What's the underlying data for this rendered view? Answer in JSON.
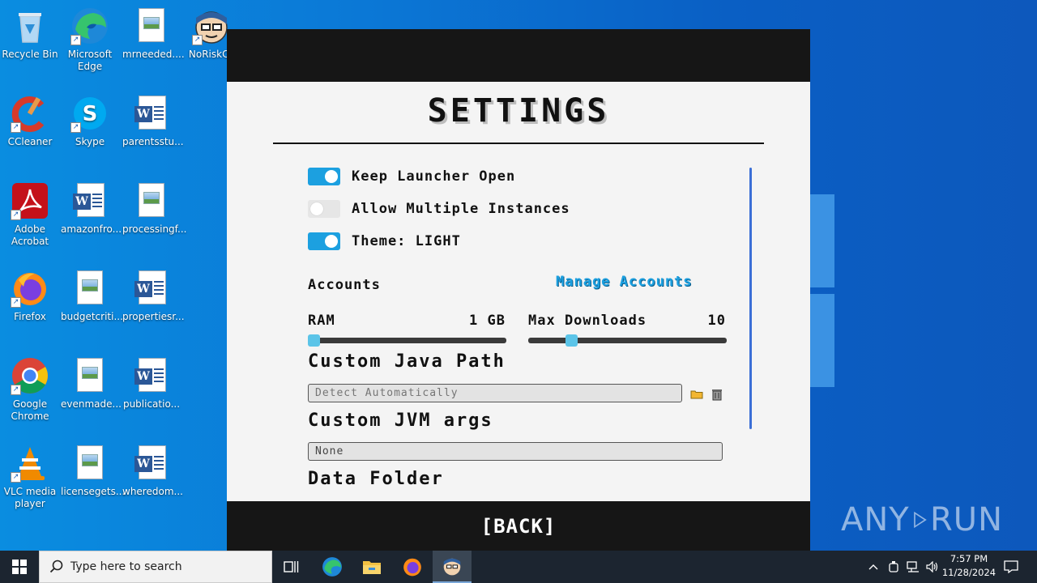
{
  "desktop": {
    "icons": [
      {
        "label": "Recycle Bin"
      },
      {
        "label": "Microsoft Edge"
      },
      {
        "label": "mrneeded...."
      },
      {
        "label": "NoRiskCli"
      },
      {
        "label": "CCleaner"
      },
      {
        "label": "Skype"
      },
      {
        "label": "parentsstu..."
      },
      {
        "label": "Adobe Acrobat"
      },
      {
        "label": "amazonfro..."
      },
      {
        "label": "processingf..."
      },
      {
        "label": "Firefox"
      },
      {
        "label": "budgetcriti..."
      },
      {
        "label": "propertiesr..."
      },
      {
        "label": "Google Chrome"
      },
      {
        "label": "evenmade..."
      },
      {
        "label": "publicatio..."
      },
      {
        "label": "VLC media player"
      },
      {
        "label": "licensegets..."
      },
      {
        "label": "wheredom..."
      }
    ],
    "watermark": {
      "left": "ANY",
      "right": "RUN"
    }
  },
  "app": {
    "title": "SETTINGS",
    "toggles": [
      {
        "label": "Keep Launcher Open",
        "on": true
      },
      {
        "label": "Allow Multiple Instances",
        "on": false
      },
      {
        "label": "Theme: LIGHT",
        "on": true
      }
    ],
    "accounts": {
      "label": "Accounts",
      "manage_link": "Manage Accounts"
    },
    "ram": {
      "label": "RAM",
      "value": "1 GB",
      "fraction": 0.0
    },
    "max_downloads": {
      "label": "Max Downloads",
      "value": "10",
      "fraction": 0.2
    },
    "java_path": {
      "heading": "Custom Java Path",
      "placeholder": "Detect Automatically"
    },
    "jvm_args": {
      "heading": "Custom JVM args",
      "value": "None"
    },
    "data_folder": {
      "heading": "Data Folder"
    },
    "back_label": "[BACK]",
    "colors": {
      "accent": "#1ca0e0",
      "bar": "#161616",
      "background": "#f4f4f4"
    }
  },
  "taskbar": {
    "search_placeholder": "Type here to search",
    "time": "7:57 PM",
    "date": "11/28/2024"
  }
}
